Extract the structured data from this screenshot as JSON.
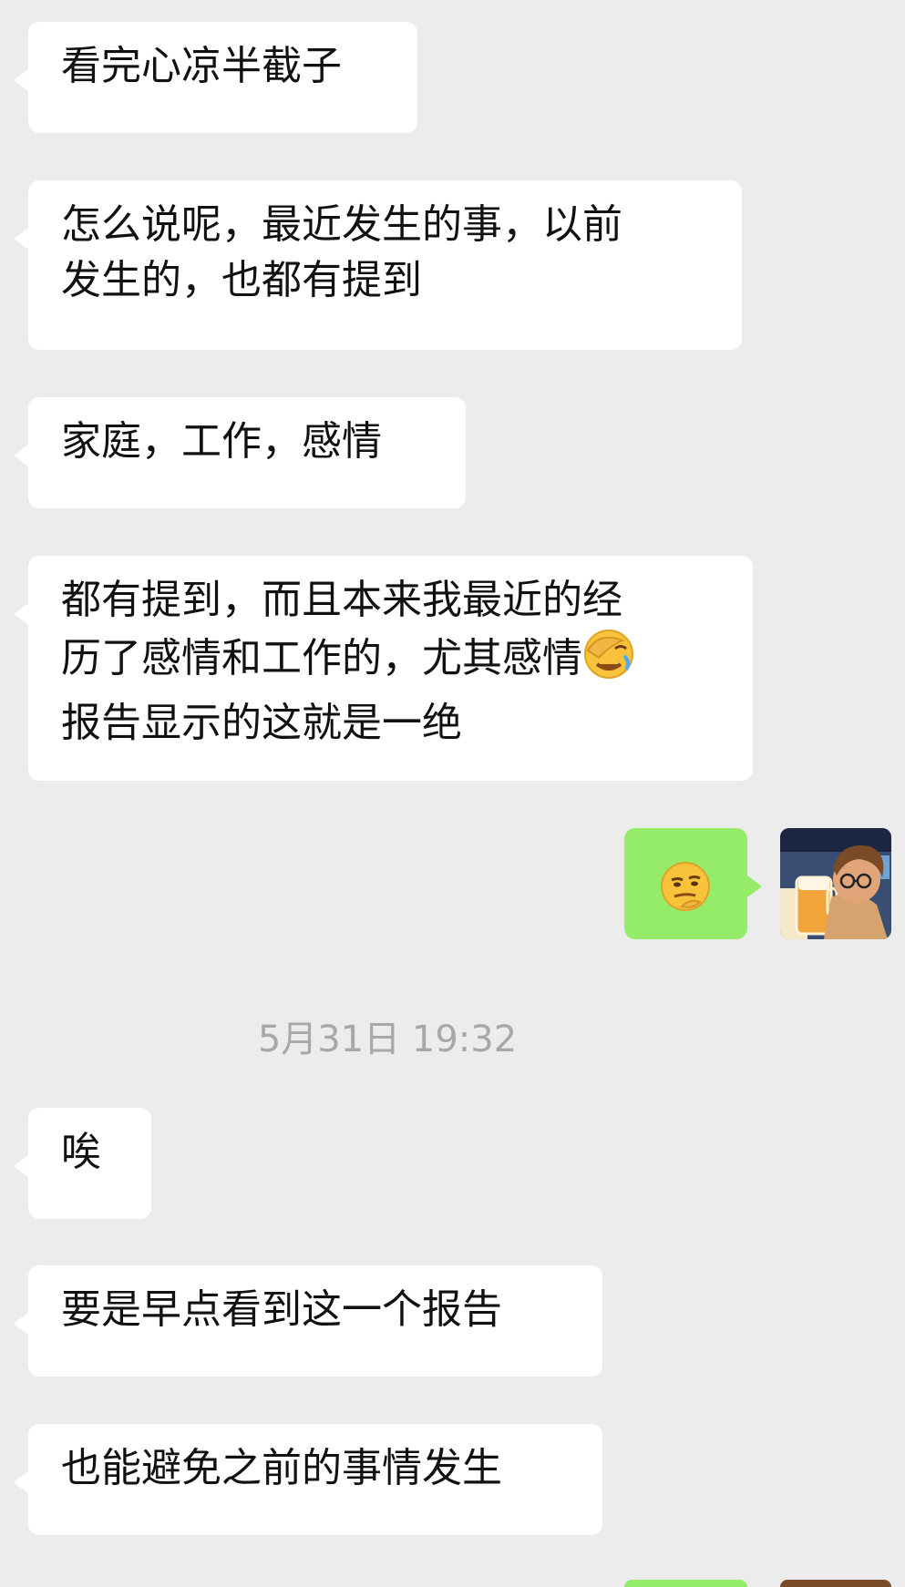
{
  "messages": [
    {
      "id": "m1",
      "text": "看完心凉半截子"
    },
    {
      "id": "m2",
      "line1": "怎么说呢，最近发生的事，以前",
      "line2": "发生的，也都有提到"
    },
    {
      "id": "m3",
      "text": "家庭，工作，感情"
    },
    {
      "id": "m4",
      "line1": "都有提到，而且本来我最近的经",
      "line2": "历了感情和工作的，尤其感情",
      "line3": "报告显示的这就是一绝"
    },
    {
      "id": "m5",
      "emoji": "thinking-smirk-emoji"
    },
    {
      "id": "m6",
      "text": "唉"
    },
    {
      "id": "m7",
      "text": "要是早点看到这一个报告"
    },
    {
      "id": "m8",
      "text": "也能避免之前的事情发生"
    }
  ],
  "timestamp": "5月31日 19:32",
  "colors": {
    "background": "#ececec",
    "incoming_bubble": "#ffffff",
    "outgoing_bubble": "#95ec69",
    "timestamp_text": "#a8a8a8"
  },
  "icons": {
    "inline_emoji": "facepalm-emoji",
    "sticker_emoji": "thinking-smirk-emoji",
    "avatar": "avatar-cartoon-boy-with-beer"
  }
}
